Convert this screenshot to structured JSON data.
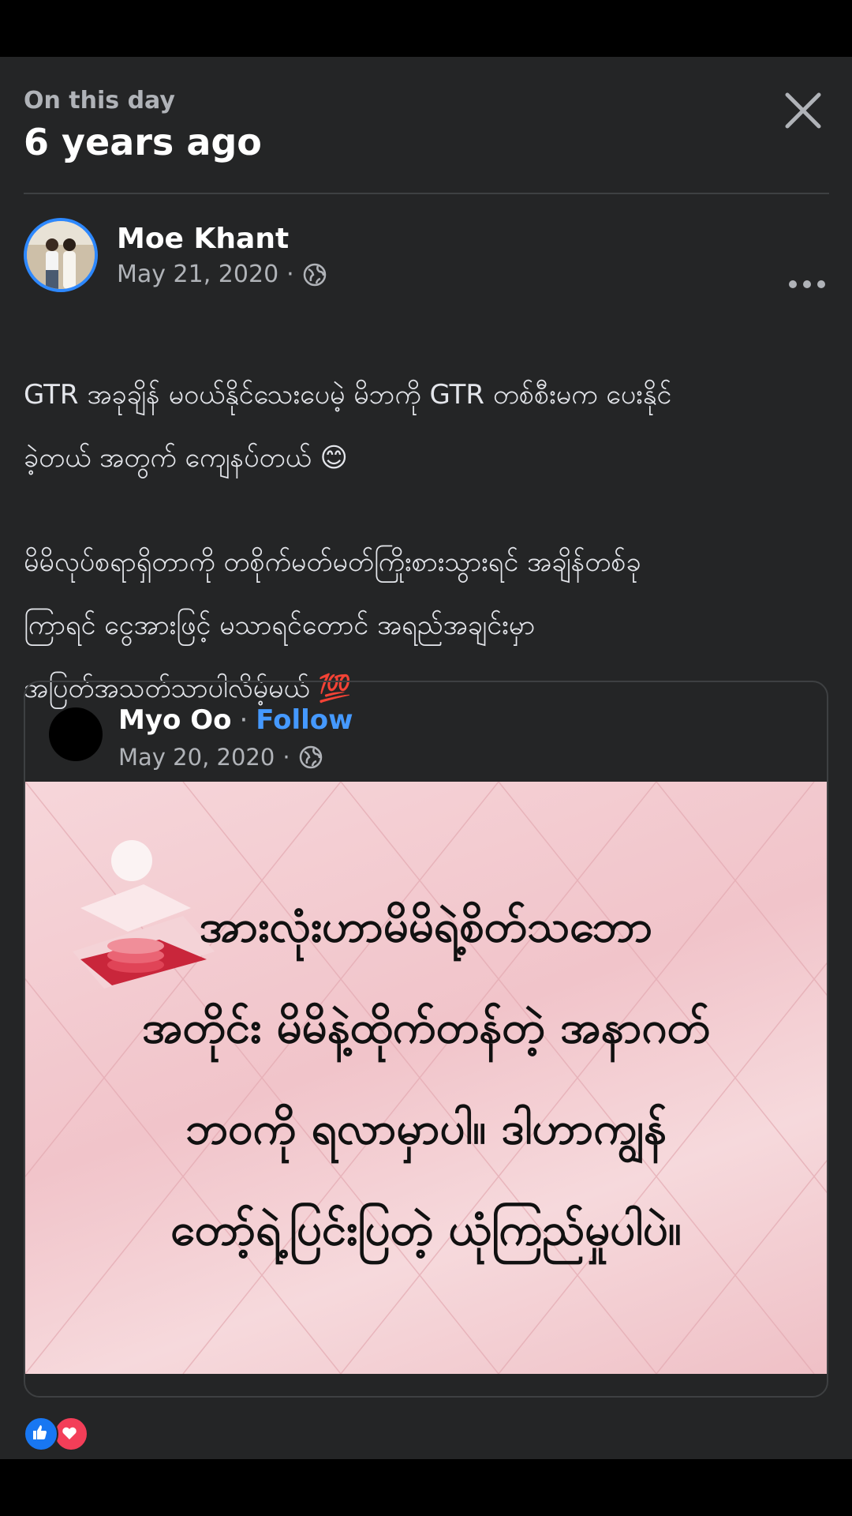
{
  "header": {
    "subtitle": "On this day",
    "title": "6 years ago"
  },
  "post": {
    "author": "Moe Khant",
    "date": "May 21, 2020",
    "separator": "·",
    "privacy_icon": "globe-icon",
    "paragraph_1": [
      "GTR အခုချိန် မဝယ်နိုင်သေးပေမဲ့ မိဘကို GTR တစ်စီးမက ပေးနိုင်",
      "ခဲ့တယ် အတွက် ကျေနပ်တယ် 😊"
    ],
    "paragraph_2": [
      "မိမိလုပ်စရာရှိတာကို တစိုက်မတ်မတ်ကြိုးစားသွားရင် အချိန်တစ်ခု",
      "ကြာရင် ငွေအားဖြင့် မသာရင်တောင် အရည်အချင်းမှာ",
      "အပြတ်အသတ်သာပါလိမ့်မယ် 💯"
    ]
  },
  "shared_post": {
    "author": "Myo Oo",
    "separator": "·",
    "follow_label": "Follow",
    "date": "May 20, 2020",
    "privacy_icon": "globe-icon",
    "image_text": [
      "အားလုံးဟာမိမိရဲ့စိတ်သဘော",
      "အတိုင်း မိမိနဲ့ထိုက်တန်တဲ့ အနာဂတ်",
      "ဘဝကို ရလာမှာပါ။ ဒါဟာကျွန်",
      "တော့်ရဲ့ပြင်းပြတဲ့ ယုံကြည်မှုပါပဲ။"
    ]
  },
  "reactions": [
    "like-icon",
    "love-icon"
  ],
  "colors": {
    "background": "#242526",
    "accent": "#2d88ff",
    "follow": "#4599ff",
    "like": "#1877f2",
    "love": "#f33e58"
  }
}
